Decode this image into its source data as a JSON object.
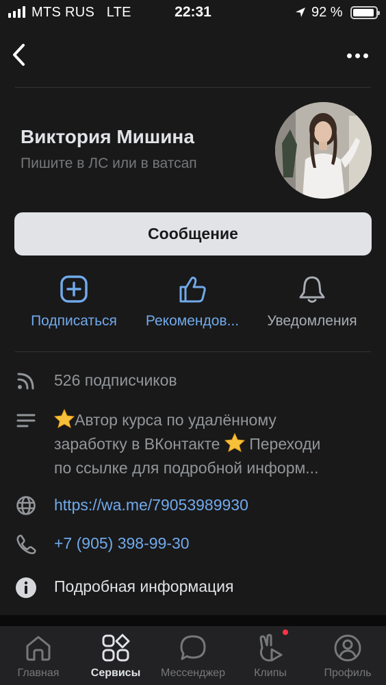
{
  "status_bar": {
    "carrier": "MTS RUS",
    "network": "LTE",
    "time": "22:31",
    "battery": "92 %"
  },
  "profile": {
    "name": "Виктория Мишина",
    "status": "Пишите в ЛС или в ватсап",
    "message_button": "Сообщение"
  },
  "actions": [
    {
      "label": "Подписаться",
      "icon": "plus-square-icon"
    },
    {
      "label": "Рекомендов...",
      "icon": "thumbs-up-icon"
    },
    {
      "label": "Уведомления",
      "icon": "bell-icon"
    }
  ],
  "info": {
    "followers": "526 подписчиков",
    "about_line1": "Автор курса по удалённому",
    "about_line2": "заработку в ВКонтакте",
    "about_line2b": " Переходи",
    "about_line3": "по ссылке для подробной информ...",
    "website": "https://wa.me/79053989930",
    "phone": "+7 (905) 398-99-30",
    "details": "Подробная информация"
  },
  "tabs": [
    {
      "label": "Главная",
      "icon": "home-icon"
    },
    {
      "label": "Сервисы",
      "icon": "services-icon"
    },
    {
      "label": "Мессенджер",
      "icon": "messenger-icon"
    },
    {
      "label": "Клипы",
      "icon": "clips-icon"
    },
    {
      "label": "Профиль",
      "icon": "profile-icon"
    }
  ],
  "colors": {
    "background": "#19191a",
    "accent": "#71aaeb",
    "button": "#e1e3e6",
    "notification_dot": "#ff3347"
  }
}
